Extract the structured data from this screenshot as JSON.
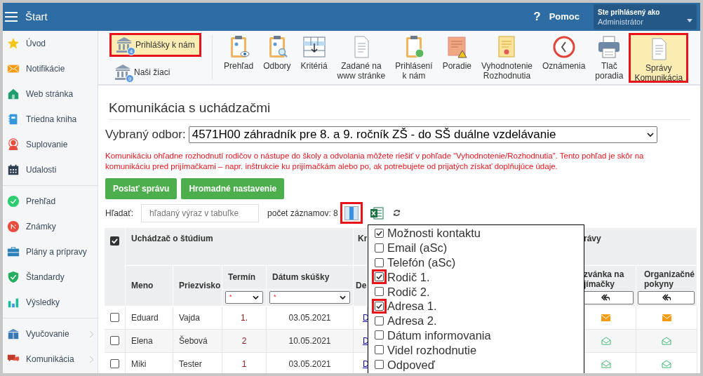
{
  "topbar": {
    "title": "Štart",
    "help_icon": "?",
    "help": "Pomoc",
    "user_caption": "Ste prihlásený ako",
    "user": "Administrátor"
  },
  "sidebar": {
    "groups": [
      [
        {
          "label": "Úvod",
          "expandable": false
        },
        {
          "label": "Notifikácie",
          "expandable": false
        },
        {
          "label": "Web stránka",
          "expandable": false
        },
        {
          "label": "Triedna kniha",
          "expandable": false
        },
        {
          "label": "Suplovanie",
          "expandable": false
        },
        {
          "label": "Udalosti",
          "expandable": false
        }
      ],
      [
        {
          "label": "Prehľad",
          "expandable": false
        },
        {
          "label": "Známky",
          "expandable": false
        },
        {
          "label": "Plány a prípravy",
          "expandable": false
        },
        {
          "label": "Štandardy",
          "expandable": false
        },
        {
          "label": "Výsledky",
          "expandable": false
        }
      ],
      [
        {
          "label": "Vyučovanie",
          "expandable": true
        },
        {
          "label": "Komunikácia",
          "expandable": true
        }
      ]
    ]
  },
  "toolbar": {
    "left": [
      {
        "label": "Prihlášky k nám",
        "badge": "4",
        "highlighted": true
      },
      {
        "label": "Naši žiaci",
        "badge": "9",
        "highlighted": false
      }
    ],
    "items": [
      {
        "lines": [
          "Prehľad"
        ],
        "highlighted": false
      },
      {
        "lines": [
          "Odbory"
        ],
        "highlighted": false
      },
      {
        "lines": [
          "Kritériá"
        ],
        "highlighted": false
      },
      {
        "lines": [
          "Zadané na",
          "www stránke"
        ],
        "highlighted": false
      },
      {
        "lines": [
          "Prihlásení",
          "k nám"
        ],
        "highlighted": false
      },
      {
        "lines": [
          "Poradie"
        ],
        "highlighted": false
      },
      {
        "lines": [
          "Vyhodnotenie",
          "Rozhodnutia"
        ],
        "highlighted": false
      },
      {
        "lines": [
          "Oznámenia"
        ],
        "highlighted": false
      },
      {
        "lines": [
          "Tlač",
          "poradia"
        ],
        "highlighted": false
      },
      {
        "lines": [
          "Správy",
          "Komunikácia"
        ],
        "highlighted": true
      }
    ]
  },
  "page": {
    "title": "Komunikácia s uchádzačmi",
    "program_label": "Vybraný odbor:",
    "program": "4571H00 záhradník pre 8. a 9. ročník ZŠ - do SŠ duálne vzdelávanie",
    "notice": "Komunikáciu ohľadne rozhodnutí rodičov o nástupe do školy a odvolania môžete riešiť v pohľade “Vyhodnotenie/Rozhodnutia”. Tento pohľad je skôr na komunikáciu pred prijímačkami – napr. inštrukcie ku prijímačkám alebo po, ak potrebujete od prijatých získať doplňujúce údaje.",
    "buttons": [
      "Poslať správu",
      "Hromadné nastavenie"
    ],
    "search_label": "Hľadať:",
    "search_placeholder": "hľadaný výraz v tabuľke",
    "record_count": "počet záznamov: 8",
    "columns_button_highlighted": true
  },
  "table": {
    "select_all": true,
    "group_headers": [
      "Uchádzač o štúdium",
      "Kr",
      "rávy"
    ],
    "columns": [
      {
        "label": "Meno"
      },
      {
        "label": "Priezvisko"
      },
      {
        "label": "Termín",
        "filter": "*"
      },
      {
        "label": "Dátum skúšky",
        "filter": "*"
      },
      {
        "label": "De"
      },
      {
        "label": "zvánka na jímačky"
      },
      {
        "label": "Organizačné pokyny"
      }
    ],
    "rows": [
      {
        "checked": false,
        "cells": [
          "Eduard",
          "Vajda",
          "1.",
          "03.05.2021",
          "D"
        ],
        "messages": [
          {
            "read": false
          },
          {
            "read": false
          }
        ]
      },
      {
        "checked": false,
        "cells": [
          "Elena",
          "Šebová",
          "2",
          "10.05.2021",
          "D"
        ],
        "messages": [
          {
            "read": true
          },
          {
            "read": true
          }
        ]
      },
      {
        "checked": false,
        "cells": [
          "Miki",
          "Tester",
          "1",
          "03.05.2021",
          "D"
        ],
        "messages": [
          {
            "read": true
          },
          {
            "read": true
          }
        ]
      }
    ]
  },
  "column_picker": {
    "items": [
      {
        "label": "Možnosti kontaktu",
        "checked": true,
        "highlighted": false
      },
      {
        "label": "Email (aSc)",
        "checked": false,
        "highlighted": false
      },
      {
        "label": "Telefón (aSc)",
        "checked": false,
        "highlighted": false
      },
      {
        "label": "Rodič 1.",
        "checked": true,
        "highlighted": true
      },
      {
        "label": "Rodič 2.",
        "checked": false,
        "highlighted": false
      },
      {
        "label": "Adresa 1.",
        "checked": true,
        "highlighted": true
      },
      {
        "label": "Adresa 2.",
        "checked": false,
        "highlighted": false
      },
      {
        "label": "Dátum informovania",
        "checked": false,
        "highlighted": false
      },
      {
        "label": "Videl rozhodnutie",
        "checked": false,
        "highlighted": false
      },
      {
        "label": "Odpoveď",
        "checked": false,
        "highlighted": false
      }
    ]
  }
}
